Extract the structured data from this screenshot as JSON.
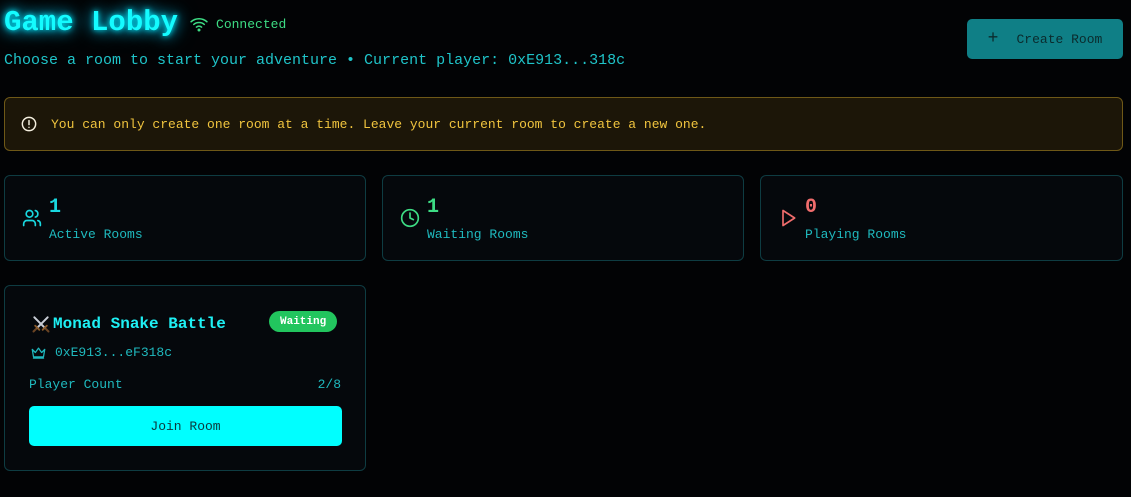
{
  "header": {
    "title": "Game Lobby",
    "connection_status": "Connected",
    "subtitle": "Choose a room to start your adventure • Current player: 0xE913...318c",
    "create_room_label": "Create Room"
  },
  "alert": {
    "message": "You can only create one room at a time. Leave your current room to create a new one."
  },
  "stats": [
    {
      "value": "1",
      "label": "Active Rooms",
      "icon": "users-icon",
      "color": "#19d8e0"
    },
    {
      "value": "1",
      "label": "Waiting Rooms",
      "icon": "clock-icon",
      "color": "#3ddc84"
    },
    {
      "value": "0",
      "label": "Playing Rooms",
      "icon": "play-icon",
      "color": "#f06c6c"
    }
  ],
  "rooms": [
    {
      "name": "Monad Snake Battle",
      "status": "Waiting",
      "owner": "0xE913...eF318c",
      "player_count_label": "Player Count",
      "player_count": "2/8",
      "join_label": "Join Room"
    }
  ],
  "colors": {
    "accent": "#00ffff",
    "status_waiting": "#22c55e",
    "warning": "#f0c43e",
    "background": "#020305"
  }
}
